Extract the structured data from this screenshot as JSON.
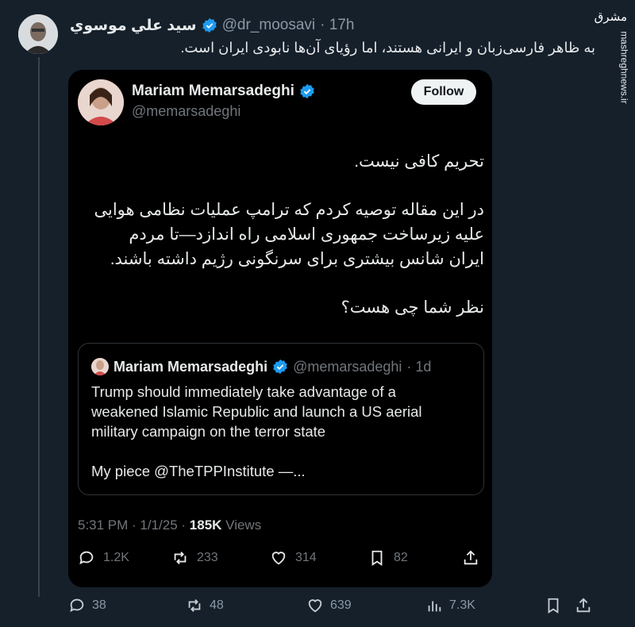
{
  "post": {
    "author_name": "سيد علي موسوي",
    "handle": "@dr_moosavi",
    "time": "· 17h",
    "text": "به ظاهر فارسی‌زبان و ایرانی هستند، اما رؤیای آن‌ها نابودی ایران است.",
    "actions": {
      "replies": "38",
      "reposts": "48",
      "likes": "639",
      "views": "7.3K"
    }
  },
  "brand": {
    "logo": "مشرق",
    "site": "mashreghnews.ir"
  },
  "embedded": {
    "name": "Mariam Memarsadeghi",
    "handle": "@memarsadeghi",
    "follow_label": "Follow",
    "paragraphs": [
      "تحریم کافی نیست.",
      "در این مقاله توصیه کردم که ترامپ عملیات نظامی هوایی علیه زیرساخت جمهوری اسلامی راه اندازد—تا مردم ایران شانس بیشتری برای سرنگونی رژیم داشته باشند.",
      "نظر شما چی هست؟"
    ],
    "quote": {
      "name": "Mariam Memarsadeghi",
      "handle": "@memarsadeghi",
      "time": "· 1d",
      "text": "Trump should immediately take advantage of a weakened Islamic Republic and launch a US aerial military campaign on the terror state",
      "link": "My piece @TheTPPInstitute —..."
    },
    "timestamp": "5:31 PM · 1/1/25 · ",
    "views_count": "185K",
    "views_label": " Views",
    "actions": {
      "replies": "1.2K",
      "reposts": "233",
      "likes": "314",
      "bookmarks": "82"
    }
  },
  "colors": {
    "background": "#15202b",
    "card": "#000000",
    "verified": "#1d9bf0",
    "muted": "#71767b"
  }
}
